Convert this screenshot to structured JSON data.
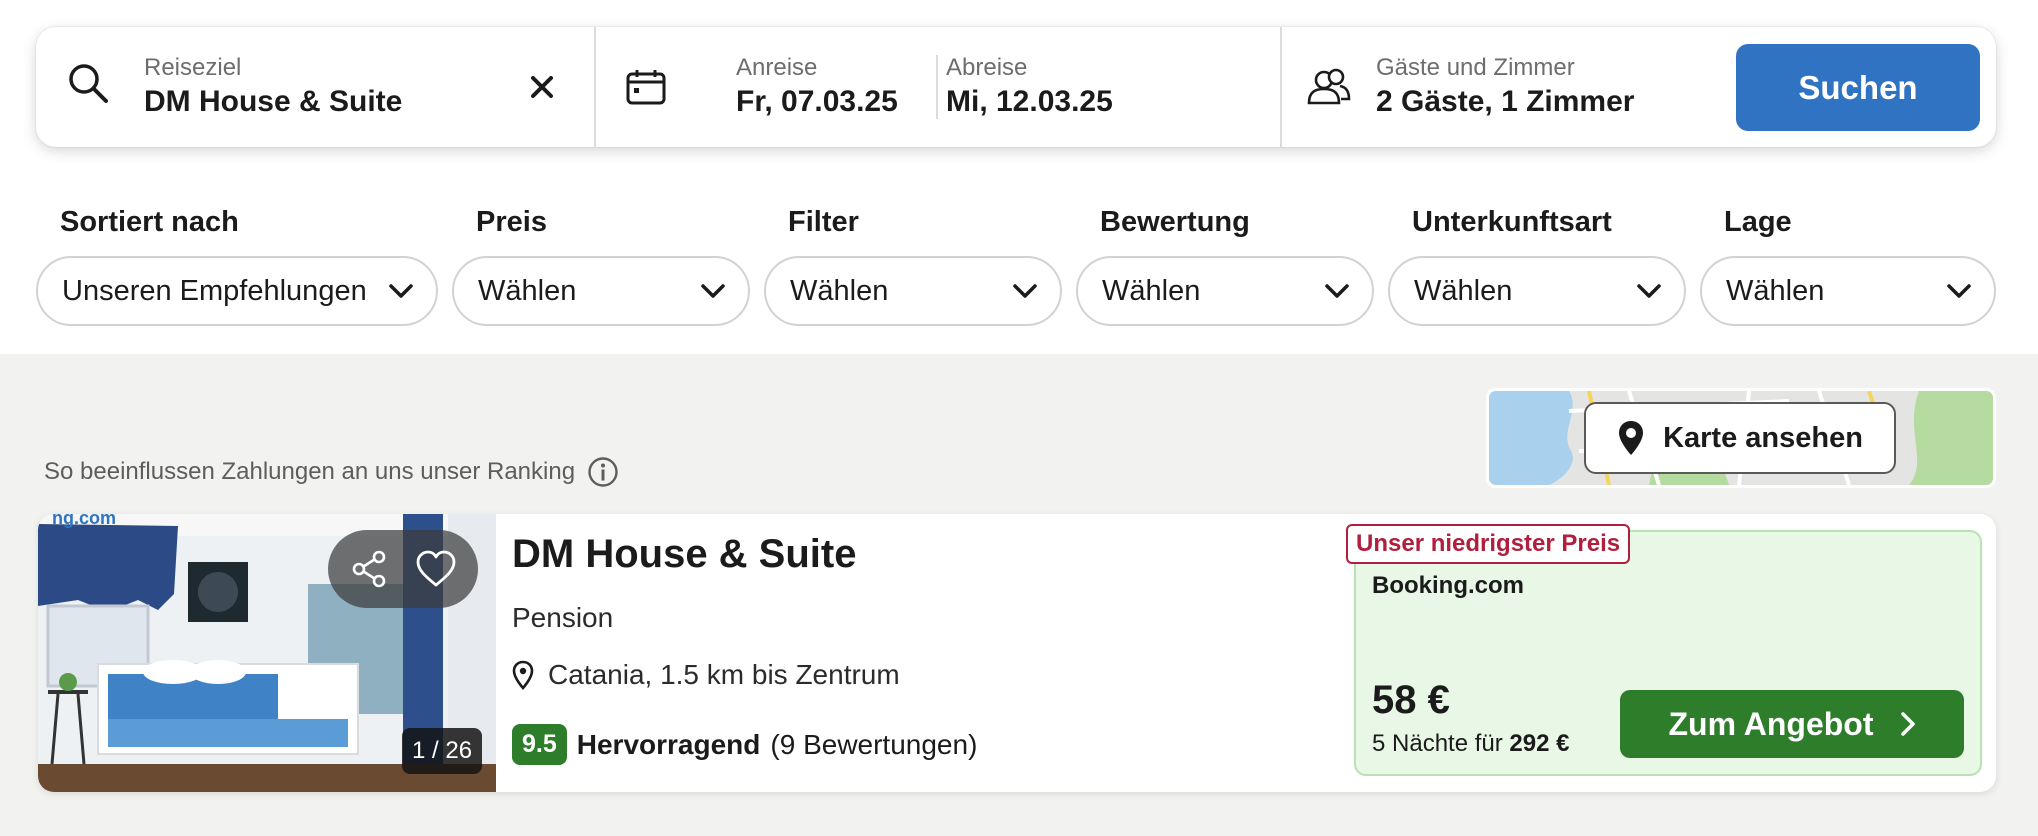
{
  "search": {
    "destination_label": "Reiseziel",
    "destination_value": "DM House & Suite",
    "checkin_label": "Anreise",
    "checkin_value": "Fr, 07.03.25",
    "checkout_label": "Abreise",
    "checkout_value": "Mi, 12.03.25",
    "guests_label": "Gäste und Zimmer",
    "guests_value": "2 Gäste, 1 Zimmer",
    "button_label": "Suchen"
  },
  "filters": [
    {
      "title": "Sortiert nach",
      "value": "Unseren Empfehlungen"
    },
    {
      "title": "Preis",
      "value": "Wählen"
    },
    {
      "title": "Filter",
      "value": "Wählen"
    },
    {
      "title": "Bewertung",
      "value": "Wählen"
    },
    {
      "title": "Unterkunftsart",
      "value": "Wählen"
    },
    {
      "title": "Lage",
      "value": "Wählen"
    }
  ],
  "ranking_note": "So beeinflussen Zahlungen an uns unser Ranking",
  "map": {
    "button_label": "Karte ansehen"
  },
  "result": {
    "name": "DM House & Suite",
    "type": "Pension",
    "location": "Catania, 1.5 km bis Zentrum",
    "score": "9.5",
    "rating_word": "Hervorragend",
    "reviews": "(9 Bewertungen)",
    "photo_counter": "1 / 26",
    "photo_watermark": "ng.com",
    "badge": "Unser niedrigster Preis",
    "provider": "Booking.com",
    "price": "58 €",
    "nights_prefix": "5 Nächte für",
    "nights_total": "292 €",
    "offer_button": "Zum Angebot"
  },
  "colors": {
    "primary_blue": "#2f73c2",
    "deal_green": "#2d7d2b",
    "deal_background": "#e8f7e6",
    "badge_red": "#b01f3d"
  }
}
